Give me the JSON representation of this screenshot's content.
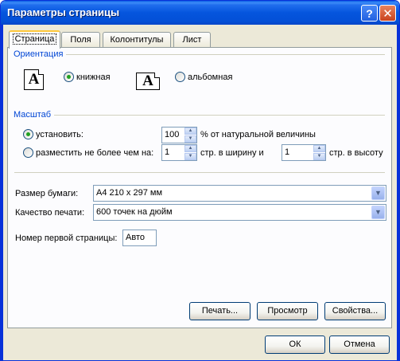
{
  "window": {
    "title": "Параметры страницы",
    "help_glyph": "?",
    "close_glyph": "✕"
  },
  "tabs": [
    {
      "label": "Страница",
      "active": true
    },
    {
      "label": "Поля"
    },
    {
      "label": "Колонтитулы"
    },
    {
      "label": "Лист"
    }
  ],
  "orientation": {
    "group_label": "Ориентация",
    "portrait_label": "книжная",
    "landscape_label": "альбомная",
    "portrait_icon_letter": "A",
    "landscape_icon_letter": "A",
    "selected": "portrait"
  },
  "scale": {
    "group_label": "Масштаб",
    "adjust_label": "установить:",
    "adjust_value": "100",
    "adjust_suffix": "% от натуральной величины",
    "fit_label": "разместить не более чем на:",
    "fit_wide_value": "1",
    "fit_wide_suffix": "стр. в ширину и",
    "fit_tall_value": "1",
    "fit_tall_suffix": "стр. в высоту",
    "selected": "adjust"
  },
  "paper": {
    "size_label": "Размер бумаги:",
    "size_value": "A4 210 x 297 мм",
    "quality_label": "Качество печати:",
    "quality_value": "600 точек на дюйм",
    "first_page_label": "Номер первой страницы:",
    "first_page_value": "Авто"
  },
  "buttons": {
    "print": "Печать...",
    "preview": "Просмотр",
    "options": "Свойства...",
    "ok": "ОК",
    "cancel": "Отмена"
  },
  "icons": {
    "spin_up": "up-arrow-icon",
    "spin_down": "down-arrow-icon",
    "combo": "chevron-down-icon",
    "up_glyph": "▲",
    "down_glyph": "▼",
    "combo_glyph": "▼"
  },
  "colors": {
    "title_bar": "#0555dd",
    "group_label": "#0046d5",
    "dialog_bg": "#ece9d8",
    "radio_checked": "#21a121"
  }
}
